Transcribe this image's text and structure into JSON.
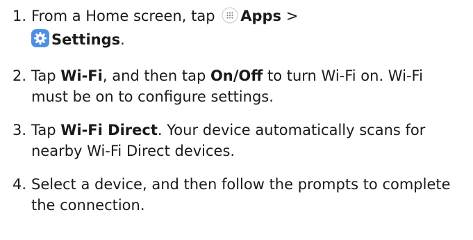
{
  "steps": [
    {
      "number": "1.",
      "text_prefix": "From a Home screen, tap ",
      "apps_icon": "apps-grid-icon",
      "apps_label": "Apps",
      "separator": " >",
      "settings_icon": "settings-gear-icon",
      "settings_label": "Settings",
      "suffix": "."
    },
    {
      "number": "2.",
      "prefix": "Tap ",
      "bold1": "Wi-Fi",
      "middle": ", and then tap ",
      "bold2": "On/Off",
      "suffix": " to turn Wi-Fi on. Wi-Fi must be on to configure settings."
    },
    {
      "number": "3.",
      "prefix": "Tap ",
      "bold1": "Wi-Fi Direct",
      "suffix": ". Your device automatically scans for nearby Wi-Fi Direct devices."
    },
    {
      "number": "4.",
      "text": "Select a device, and then follow the prompts to complete the connection."
    }
  ],
  "colors": {
    "text": "#1a1a1a",
    "settings_icon_bg": "#4f8fe0"
  }
}
